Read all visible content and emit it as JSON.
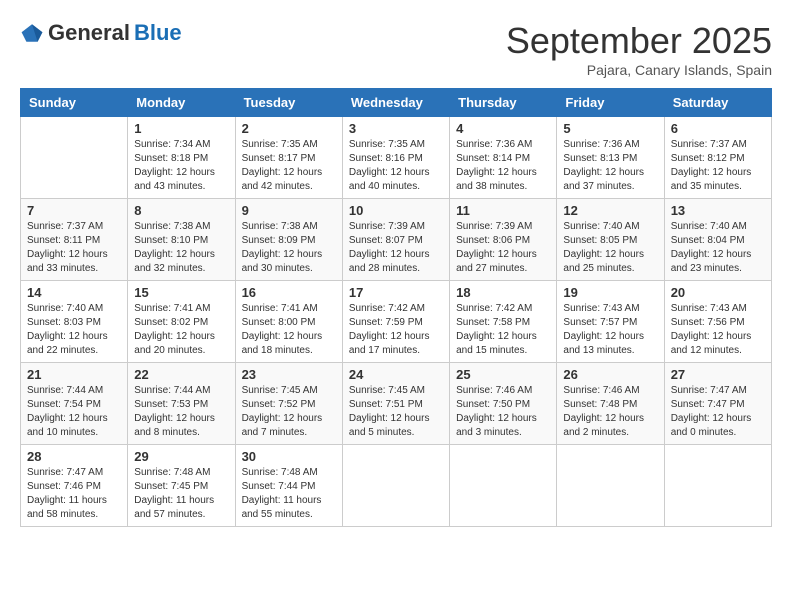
{
  "header": {
    "logo_general": "General",
    "logo_blue": "Blue",
    "month_title": "September 2025",
    "subtitle": "Pajara, Canary Islands, Spain"
  },
  "days_of_week": [
    "Sunday",
    "Monday",
    "Tuesday",
    "Wednesday",
    "Thursday",
    "Friday",
    "Saturday"
  ],
  "weeks": [
    [
      {
        "day": "",
        "info": ""
      },
      {
        "day": "1",
        "info": "Sunrise: 7:34 AM\nSunset: 8:18 PM\nDaylight: 12 hours\nand 43 minutes."
      },
      {
        "day": "2",
        "info": "Sunrise: 7:35 AM\nSunset: 8:17 PM\nDaylight: 12 hours\nand 42 minutes."
      },
      {
        "day": "3",
        "info": "Sunrise: 7:35 AM\nSunset: 8:16 PM\nDaylight: 12 hours\nand 40 minutes."
      },
      {
        "day": "4",
        "info": "Sunrise: 7:36 AM\nSunset: 8:14 PM\nDaylight: 12 hours\nand 38 minutes."
      },
      {
        "day": "5",
        "info": "Sunrise: 7:36 AM\nSunset: 8:13 PM\nDaylight: 12 hours\nand 37 minutes."
      },
      {
        "day": "6",
        "info": "Sunrise: 7:37 AM\nSunset: 8:12 PM\nDaylight: 12 hours\nand 35 minutes."
      }
    ],
    [
      {
        "day": "7",
        "info": "Sunrise: 7:37 AM\nSunset: 8:11 PM\nDaylight: 12 hours\nand 33 minutes."
      },
      {
        "day": "8",
        "info": "Sunrise: 7:38 AM\nSunset: 8:10 PM\nDaylight: 12 hours\nand 32 minutes."
      },
      {
        "day": "9",
        "info": "Sunrise: 7:38 AM\nSunset: 8:09 PM\nDaylight: 12 hours\nand 30 minutes."
      },
      {
        "day": "10",
        "info": "Sunrise: 7:39 AM\nSunset: 8:07 PM\nDaylight: 12 hours\nand 28 minutes."
      },
      {
        "day": "11",
        "info": "Sunrise: 7:39 AM\nSunset: 8:06 PM\nDaylight: 12 hours\nand 27 minutes."
      },
      {
        "day": "12",
        "info": "Sunrise: 7:40 AM\nSunset: 8:05 PM\nDaylight: 12 hours\nand 25 minutes."
      },
      {
        "day": "13",
        "info": "Sunrise: 7:40 AM\nSunset: 8:04 PM\nDaylight: 12 hours\nand 23 minutes."
      }
    ],
    [
      {
        "day": "14",
        "info": "Sunrise: 7:40 AM\nSunset: 8:03 PM\nDaylight: 12 hours\nand 22 minutes."
      },
      {
        "day": "15",
        "info": "Sunrise: 7:41 AM\nSunset: 8:02 PM\nDaylight: 12 hours\nand 20 minutes."
      },
      {
        "day": "16",
        "info": "Sunrise: 7:41 AM\nSunset: 8:00 PM\nDaylight: 12 hours\nand 18 minutes."
      },
      {
        "day": "17",
        "info": "Sunrise: 7:42 AM\nSunset: 7:59 PM\nDaylight: 12 hours\nand 17 minutes."
      },
      {
        "day": "18",
        "info": "Sunrise: 7:42 AM\nSunset: 7:58 PM\nDaylight: 12 hours\nand 15 minutes."
      },
      {
        "day": "19",
        "info": "Sunrise: 7:43 AM\nSunset: 7:57 PM\nDaylight: 12 hours\nand 13 minutes."
      },
      {
        "day": "20",
        "info": "Sunrise: 7:43 AM\nSunset: 7:56 PM\nDaylight: 12 hours\nand 12 minutes."
      }
    ],
    [
      {
        "day": "21",
        "info": "Sunrise: 7:44 AM\nSunset: 7:54 PM\nDaylight: 12 hours\nand 10 minutes."
      },
      {
        "day": "22",
        "info": "Sunrise: 7:44 AM\nSunset: 7:53 PM\nDaylight: 12 hours\nand 8 minutes."
      },
      {
        "day": "23",
        "info": "Sunrise: 7:45 AM\nSunset: 7:52 PM\nDaylight: 12 hours\nand 7 minutes."
      },
      {
        "day": "24",
        "info": "Sunrise: 7:45 AM\nSunset: 7:51 PM\nDaylight: 12 hours\nand 5 minutes."
      },
      {
        "day": "25",
        "info": "Sunrise: 7:46 AM\nSunset: 7:50 PM\nDaylight: 12 hours\nand 3 minutes."
      },
      {
        "day": "26",
        "info": "Sunrise: 7:46 AM\nSunset: 7:48 PM\nDaylight: 12 hours\nand 2 minutes."
      },
      {
        "day": "27",
        "info": "Sunrise: 7:47 AM\nSunset: 7:47 PM\nDaylight: 12 hours\nand 0 minutes."
      }
    ],
    [
      {
        "day": "28",
        "info": "Sunrise: 7:47 AM\nSunset: 7:46 PM\nDaylight: 11 hours\nand 58 minutes."
      },
      {
        "day": "29",
        "info": "Sunrise: 7:48 AM\nSunset: 7:45 PM\nDaylight: 11 hours\nand 57 minutes."
      },
      {
        "day": "30",
        "info": "Sunrise: 7:48 AM\nSunset: 7:44 PM\nDaylight: 11 hours\nand 55 minutes."
      },
      {
        "day": "",
        "info": ""
      },
      {
        "day": "",
        "info": ""
      },
      {
        "day": "",
        "info": ""
      },
      {
        "day": "",
        "info": ""
      }
    ]
  ]
}
